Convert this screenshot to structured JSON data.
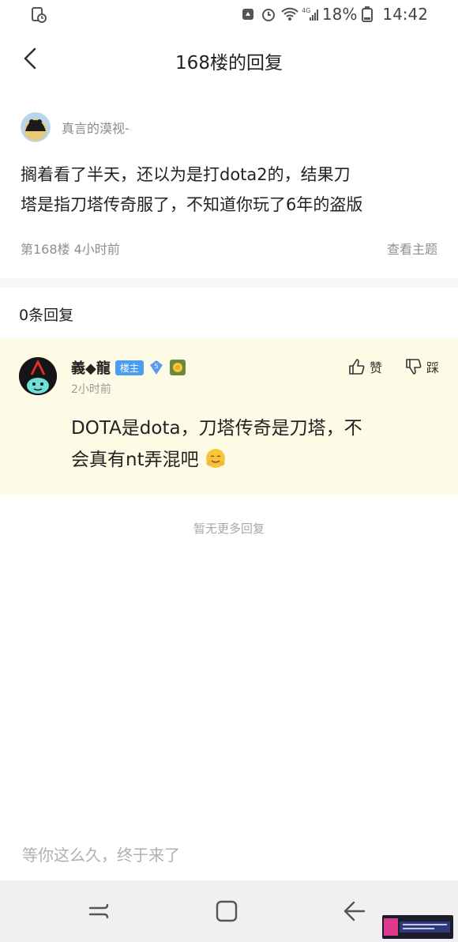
{
  "status": {
    "battery": "18%",
    "time": "14:42",
    "network": "4G"
  },
  "nav": {
    "title": "168楼的回复"
  },
  "post": {
    "author": "真言的漠视-",
    "text_line1": "搁着看了半天，还以为是打dota2的，结果刀",
    "text_line2": "塔是指刀塔传奇服了，不知道你玩了6年的盗版",
    "floor_time": "第168楼  4小时前",
    "view_topic": "查看主题"
  },
  "replies": {
    "count_label": "0条回复",
    "items": [
      {
        "name": "義◆龍",
        "host_badge": "楼主",
        "level": "5",
        "time": "2小时前",
        "like": "赞",
        "dislike": "踩",
        "text_line1": "DOTA是dota，刀塔传奇是刀塔，不",
        "text_line2": "会真有nt弄混吧"
      }
    ],
    "no_more": "暂无更多回复"
  },
  "input": {
    "placeholder": "等你这么久，终于来了"
  },
  "colors": {
    "reply_bg": "#fdfbe6",
    "host_badge": "#4a9df0",
    "muted_text": "#8f8f8f"
  }
}
